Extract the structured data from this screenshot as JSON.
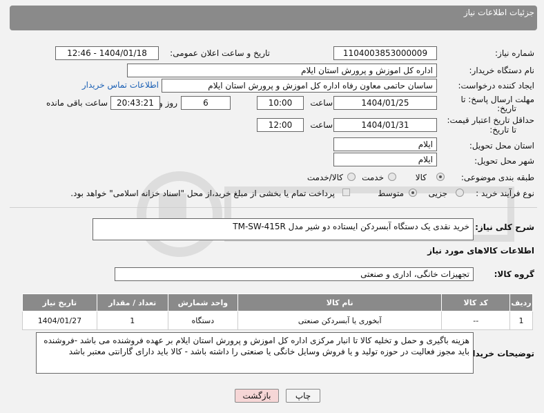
{
  "header": {
    "title": "جزئیات اطلاعات نیاز"
  },
  "form": {
    "need_number_label": "شماره نیاز:",
    "need_number": "1104003853000009",
    "announce_label": "تاریخ و ساعت اعلان عمومی:",
    "announce_value": "1404/01/18 - 12:46",
    "buyer_label": "نام دستگاه خریدار:",
    "buyer_value": "اداره کل اموزش و پرورش استان ایلام",
    "creator_label": "ایجاد کننده درخواست:",
    "creator_value": "ساسان حاتمی معاون رفاه  اداره کل اموزش و پرورش استان ایلام",
    "contact_link": "اطلاعات تماس خریدار",
    "deadline_label_1": "مهلت ارسال پاسخ: تا",
    "deadline_label_2": "تاریخ:",
    "deadline_date": "1404/01/25",
    "time_label": "ساعت",
    "deadline_time": "10:00",
    "days_value": "6",
    "days_label": "روز و",
    "remaining_time": "20:43:21",
    "remaining_label": "ساعت باقی مانده",
    "validity_label_1": "حداقل تاریخ اعتبار قیمت:",
    "validity_label_2": "تا تاریخ:",
    "validity_date": "1404/01/31",
    "validity_time": "12:00",
    "province_label": "استان محل تحویل:",
    "province_value": "ایلام",
    "city_label": "شهر محل تحویل:",
    "city_value": "ایلام",
    "category_label": "طبقه بندی موضوعی:",
    "category_options": [
      "کالا",
      "خدمت",
      "کالا/خدمت"
    ],
    "purchase_label": "نوع فرآیند خرید :",
    "purchase_options": [
      "جزیی",
      "متوسط"
    ],
    "payment_note": "پرداخت تمام یا بخشی از مبلغ خرید،از محل \"اسناد خزانه اسلامی\" خواهد بود."
  },
  "description": {
    "label": "شرح کلی نیاز:",
    "value": "خرید نقدی یک دستگاه آبسردکن ایستاده دو شیر مدل TM-SW-415R"
  },
  "goods": {
    "section_title": "اطلاعات کالاهای مورد نیاز",
    "group_label": "گروه کالا:",
    "group_value": "تجهیزات خانگی، اداری و صنعتی",
    "columns": [
      "ردیف",
      "کد کالا",
      "نام کالا",
      "واحد شمارش",
      "تعداد / مقدار",
      "تاریخ نیاز"
    ],
    "rows": [
      [
        "1",
        "--",
        "آبخوری یا آبسردکن صنعتی",
        "دستگاه",
        "1",
        "1404/01/27"
      ]
    ]
  },
  "buyer_notes": {
    "label": "توضیحات خریدار:",
    "value": "هزینه باگیری و حمل و تخلیه کالا تا انبار مرکزی اداره کل اموزش و پرورش استان ایلام بر عهده فروشنده می باشد -فروشنده باید مجوز فعالیت در حوزه تولید و یا فروش وسایل خانگی یا صنعتی را داشته باشد - کالا باید دارای گارانتی معتبر باشد"
  },
  "buttons": {
    "print": "چاپ",
    "back": "بازگشت"
  },
  "colors": {
    "header_bg": "#8a8a8a",
    "link": "#1a5fb4",
    "back_button": "#f6d6d6"
  }
}
